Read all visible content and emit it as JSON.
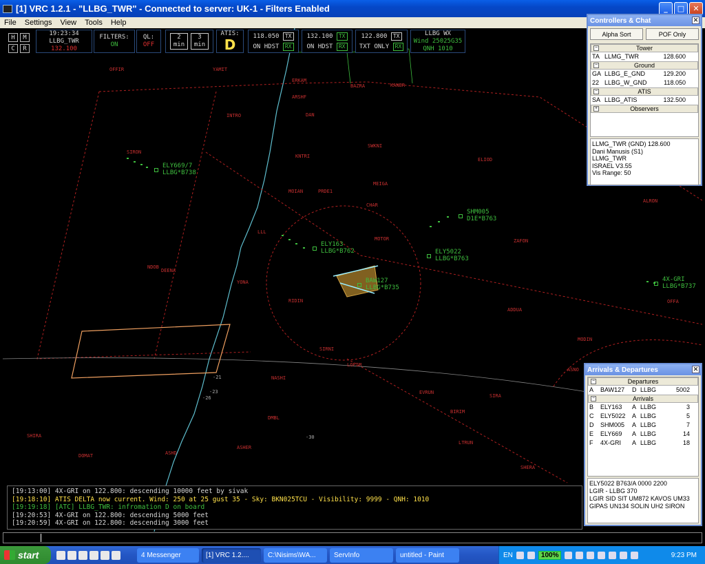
{
  "window": {
    "title": "[1] VRC 1.2.1 - \"LLBG_TWR\" - Connected to server: UK-1 - Filters Enabled",
    "menu": [
      "File",
      "Settings",
      "View",
      "Tools",
      "Help"
    ]
  },
  "toolbar": {
    "hm_buttons": [
      "H",
      "M",
      "C",
      "R"
    ],
    "time": "19:23:34",
    "callsign": "LLBG_TWR",
    "frequency": "132.100",
    "filters_label": "FILTERS:",
    "filters_value": "ON",
    "ql_label": "QL:",
    "ql_value": "OFF",
    "timer1_value": "2",
    "timer1_unit": "min",
    "timer2_value": "3",
    "timer2_unit": "min",
    "atis_label": "ATIS:",
    "atis_code": "D",
    "radios": [
      {
        "freq": "118.050",
        "mode": "ON HDST",
        "tx": "TX",
        "rx": "RX"
      },
      {
        "freq": "132.100",
        "mode": "ON HDST",
        "tx": "TX",
        "rx": "RX"
      },
      {
        "freq": "122.800",
        "mode": "TXT ONLY",
        "tx": "TX",
        "rx": "RX"
      }
    ],
    "wx_station": "LLBG WX",
    "wx_wind": "Wind 25025G35",
    "wx_qnh": "QNH 1010"
  },
  "map_labels": {
    "fixes": [
      "OFFIR",
      "YAMIT",
      "ERKAM",
      "BAZRA",
      "KANER",
      "ARSHF",
      "INTRO",
      "SIRON",
      "SWKNI",
      "KNTRI",
      "ELIOD",
      "DAN",
      "MOIAN",
      "PRDE1",
      "MEIGA",
      "CHAR",
      "MOTOR",
      "ZAFON",
      "ALRON",
      "DEENA",
      "YONA",
      "RIDIN",
      "ADDUA",
      "OFFA",
      "MODIN",
      "NASHI",
      "ASHER",
      "DMBL",
      "ASHD",
      "SHIRA",
      "DOMAT",
      "ASNO",
      "SIRA",
      "BIRIM",
      "LTRUN",
      "SHERA",
      "EVRUN",
      "SIRNI",
      "LOFIM",
      "NDOB",
      "LLL"
    ],
    "runway_ids": [
      "-21",
      "-23",
      "-26",
      "-30"
    ]
  },
  "traffic": [
    {
      "callsign": "ELY669/7",
      "info": "LLBG*B738"
    },
    {
      "callsign": "SHM005",
      "info": "D1E*B763"
    },
    {
      "callsign": "ELY163",
      "info": "LLBG*B762"
    },
    {
      "callsign": "ELY5022",
      "info": "LLBG*B763"
    },
    {
      "callsign": "BAW127",
      "info": "LLBG*B735"
    },
    {
      "callsign": "4X-GRI",
      "info": "LLBG*B737"
    }
  ],
  "log": [
    {
      "text": "[19:13:00] 4X-GRI on 122.800: descending 10000 feet by sivak",
      "color": "#d8d8d8"
    },
    {
      "text": "[19:18:10] ATIS DELTA now current. Wind: 250 at 25 gust 35 - Sky: BKN025TCU - Visibility: 9999 - QNH: 1010",
      "color": "#ffe14a"
    },
    {
      "text": "[19:19:18] [ATC] LLBG_TWR: infromation D on board",
      "color": "#3fbf3f"
    },
    {
      "text": "[19:20:53] 4X-GRI on 122.800: descending 5000 feet",
      "color": "#d8d8d8"
    },
    {
      "text": "[19:20:59] 4X-GRI on 122.800: descending 3000 feet",
      "color": "#d8d8d8"
    }
  ],
  "controllers": {
    "title": "Controllers & Chat",
    "alpha_sort": "Alpha Sort",
    "pof_only": "POF Only",
    "groups": [
      {
        "name": "Tower",
        "rows": [
          [
            "TA",
            "LLMG_TWR",
            "128.600"
          ]
        ]
      },
      {
        "name": "Ground",
        "rows": [
          [
            "GA",
            "LLBG_E_GND",
            "129.200"
          ],
          [
            "22",
            "LLBG_W_GND",
            "118.050"
          ]
        ]
      },
      {
        "name": "ATIS",
        "rows": [
          [
            "SA",
            "LLBG_ATIS",
            "132.500"
          ]
        ]
      },
      {
        "name": "Observers",
        "rows": []
      }
    ],
    "info": [
      "LLMG_TWR (GND) 128.600",
      "Dani Manusis (S1)",
      "LLMG_TWR",
      "ISRAEL V3.55",
      "Vis Range: 50"
    ]
  },
  "arrdep": {
    "title": "Arrivals & Departures",
    "departures_label": "Departures",
    "arrivals_label": "Arrivals",
    "departures": [
      [
        "A",
        "BAW127",
        "D",
        "LLBG",
        "5002"
      ]
    ],
    "arrivals": [
      [
        "B",
        "ELY163",
        "A",
        "LLBG",
        "3"
      ],
      [
        "C",
        "ELY5022",
        "A",
        "LLBG",
        "5"
      ],
      [
        "D",
        "SHM005",
        "A",
        "LLBG",
        "7"
      ],
      [
        "E",
        "ELY669",
        "A",
        "LLBG",
        "14"
      ],
      [
        "F",
        "4X-GRI",
        "A",
        "LLBG",
        "18"
      ]
    ],
    "info": [
      "ELY5022  B763/A  0000  2200",
      "LGIR - LLBG  370",
      "LGIR SID SIT UM872 KAVOS UM33",
      "GIPAS UN134 SOLIN UH2 SIRON"
    ]
  },
  "taskbar": {
    "start": "start",
    "tasks": [
      "4 Messenger",
      "[1] VRC 1.2....",
      "C:\\Nisims\\WA...",
      "ServInfo",
      "untitled - Paint"
    ],
    "lang": "EN",
    "zoom": "100%",
    "clock": "9:23 PM"
  },
  "colors": {
    "green": "#3fbf3f",
    "red": "#e03030",
    "yellow": "#ffe14a",
    "coast": "#5fbfcf"
  }
}
